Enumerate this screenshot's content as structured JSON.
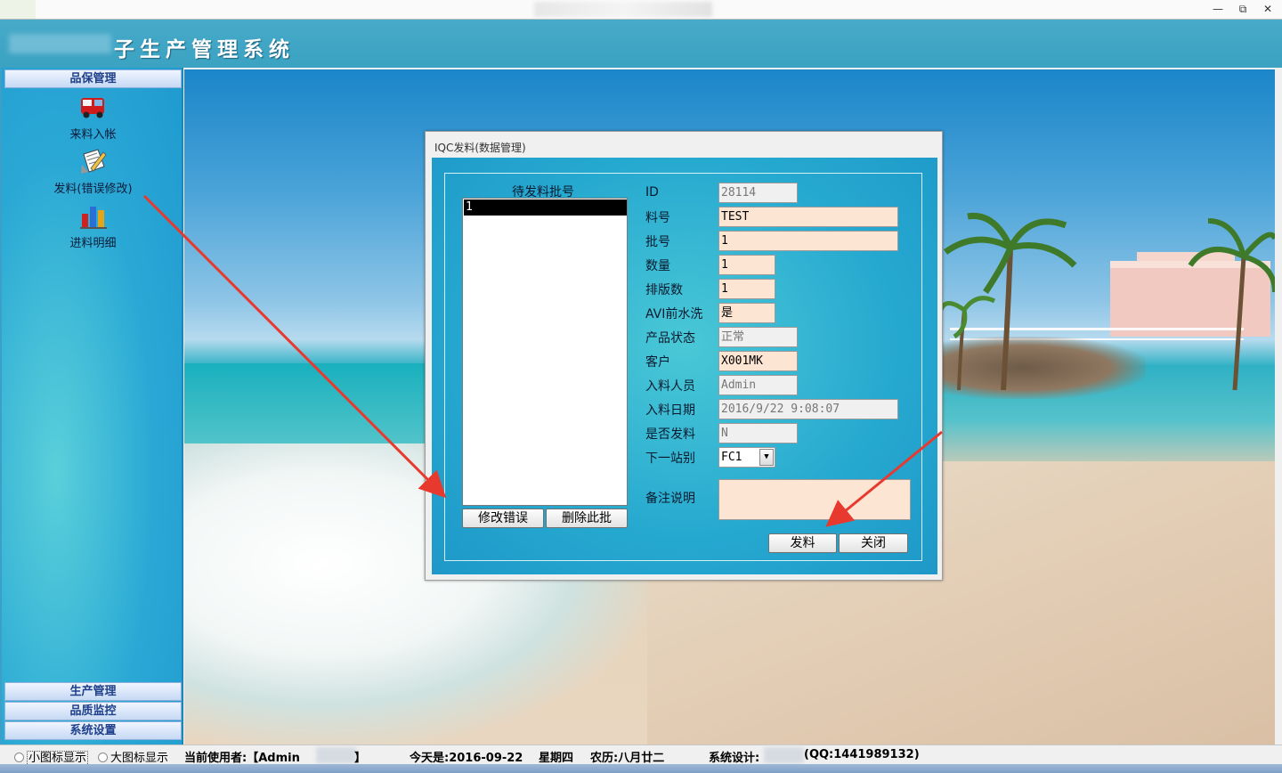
{
  "window": {
    "minimize": "—",
    "restore": "⧉",
    "close": "✕"
  },
  "app": {
    "title_suffix": "子生产管理系统"
  },
  "sidebar": {
    "sections": {
      "top": "品保管理",
      "bottom": [
        "生产管理",
        "品质监控",
        "系统设置"
      ]
    },
    "items": [
      {
        "label": "来料入帐",
        "icon": "truck-icon"
      },
      {
        "label": "发料(错误修改)",
        "icon": "edit-document-icon"
      },
      {
        "label": "进料明细",
        "icon": "bar-chart-icon"
      }
    ]
  },
  "dialog": {
    "title": "IQC发料(数据管理)",
    "list_caption": "待发料批号",
    "list_items": [
      "1"
    ],
    "buttons": {
      "edit_error": "修改错误",
      "delete_batch": "删除此批",
      "issue": "发料",
      "close": "关闭"
    },
    "fields": {
      "id": {
        "label": "ID",
        "value": "28114"
      },
      "part_no": {
        "label": "料号",
        "value": "TEST"
      },
      "batch_no": {
        "label": "批号",
        "value": "1"
      },
      "quantity": {
        "label": "数量",
        "value": "1"
      },
      "panel_count": {
        "label": "排版数",
        "value": "1"
      },
      "avi_wash": {
        "label": "AVI前水洗",
        "value": "是"
      },
      "product_status": {
        "label": "产品状态",
        "value": "正常"
      },
      "customer": {
        "label": "客户",
        "value": "X001MK"
      },
      "receiver": {
        "label": "入料人员",
        "value": "Admin"
      },
      "receive_date": {
        "label": "入料日期",
        "value": "2016/9/22 9:08:07"
      },
      "issued": {
        "label": "是否发料",
        "value": "N"
      },
      "next_station": {
        "label": "下一站别",
        "value": "FC1"
      },
      "remark": {
        "label": "备注说明",
        "value": ""
      }
    }
  },
  "statusbar": {
    "small_icons": "小图标显示",
    "large_icons": "大图标显示",
    "current_user": "当前使用者:【Admin",
    "current_user_end": "】",
    "today": "今天是:2016-09-22",
    "weekday": "星期四",
    "lunar": "农历:八月廿二",
    "designer": "系统设计:",
    "qq": "(QQ:1441989132)"
  }
}
